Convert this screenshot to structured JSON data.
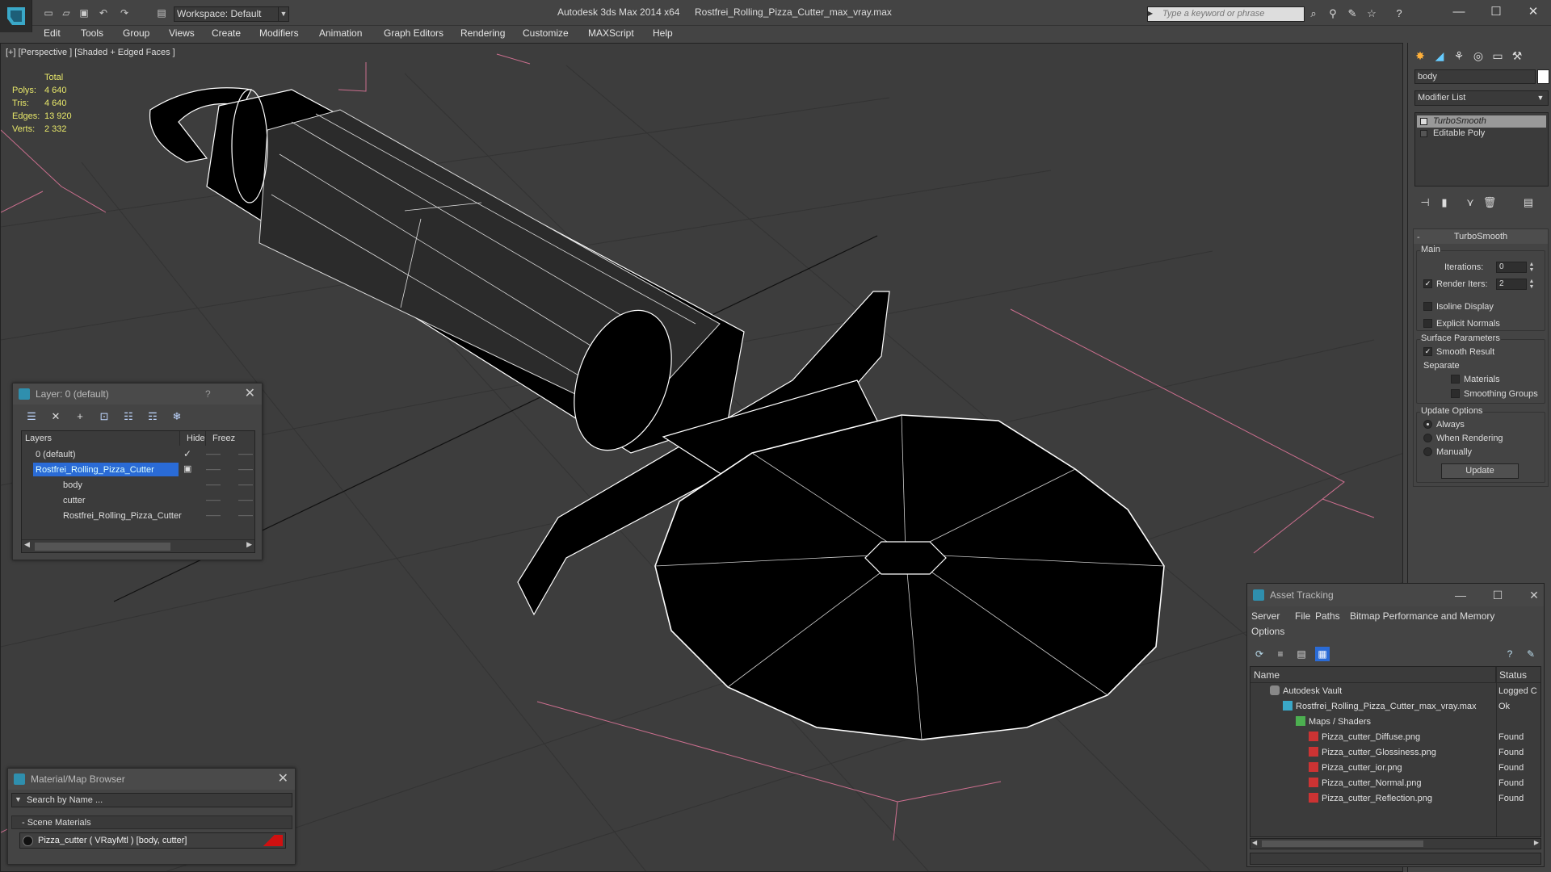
{
  "titlebar": {
    "app_title": "Autodesk 3ds Max  2014 x64",
    "file_title": "Rostfrei_Rolling_Pizza_Cutter_max_vray.max",
    "workspace": "Workspace: Default",
    "keyword_placeholder": "Type a keyword or phrase"
  },
  "menu": [
    "Edit",
    "Tools",
    "Group",
    "Views",
    "Create",
    "Modifiers",
    "Animation",
    "Graph Editors",
    "Rendering",
    "Customize",
    "MAXScript",
    "Help"
  ],
  "viewport": {
    "label": "[+] [Perspective ] [Shaded + Edged Faces ]",
    "stats": {
      "header": "Total",
      "polys_label": "Polys:",
      "polys": "4 640",
      "tris_label": "Tris:",
      "tris": "4 640",
      "edges_label": "Edges:",
      "edges": "13 920",
      "verts_label": "Verts:",
      "verts": "2 332"
    }
  },
  "command_panel": {
    "object_name": "body",
    "modifier_list": "Modifier List",
    "stack": [
      "TurboSmooth",
      "Editable Poly"
    ],
    "turbosmooth": {
      "title": "TurboSmooth",
      "main": "Main",
      "iterations_label": "Iterations:",
      "iterations": "0",
      "render_iters_label": "Render Iters:",
      "render_iters": "2",
      "isoline": "Isoline Display",
      "explicit_normals": "Explicit Normals",
      "surface_params": "Surface Parameters",
      "smooth_result": "Smooth Result",
      "separate": "Separate",
      "materials": "Materials",
      "smoothing_groups": "Smoothing Groups",
      "update_options": "Update Options",
      "always": "Always",
      "when_rendering": "When Rendering",
      "manually": "Manually",
      "update_btn": "Update"
    }
  },
  "layer_panel": {
    "title": "Layer: 0 (default)",
    "help": "?",
    "col_layers": "Layers",
    "col_hide": "Hide",
    "col_freeze": "Freez",
    "rows": [
      "0 (default)",
      "Rostfrei_Rolling_Pizza_Cutter",
      "body",
      "cutter",
      "Rostfrei_Rolling_Pizza_Cutter"
    ]
  },
  "material_browser": {
    "title": "Material/Map Browser",
    "search_placeholder": "Search by Name ...",
    "group": "- Scene Materials",
    "item": "Pizza_cutter  ( VRayMtl ) [body, cutter]"
  },
  "asset_tracking": {
    "title": "Asset Tracking",
    "menu": [
      "Server",
      "File",
      "Paths",
      "Bitmap Performance and Memory",
      "Options"
    ],
    "col_name": "Name",
    "col_status": "Status",
    "rows": [
      {
        "name": "Autodesk Vault",
        "status": "Logged C"
      },
      {
        "name": "Rostfrei_Rolling_Pizza_Cutter_max_vray.max",
        "status": "Ok"
      },
      {
        "name": "Maps / Shaders",
        "status": ""
      },
      {
        "name": "Pizza_cutter_Diffuse.png",
        "status": "Found"
      },
      {
        "name": "Pizza_cutter_Glossiness.png",
        "status": "Found"
      },
      {
        "name": "Pizza_cutter_ior.png",
        "status": "Found"
      },
      {
        "name": "Pizza_cutter_Normal.png",
        "status": "Found"
      },
      {
        "name": "Pizza_cutter_Reflection.png",
        "status": "Found"
      }
    ]
  },
  "colors": {
    "selection": "#2a6bd6",
    "stats": "#e8e86a",
    "grid_line": "#cc6f8f",
    "material_swatch": "#d01010"
  }
}
